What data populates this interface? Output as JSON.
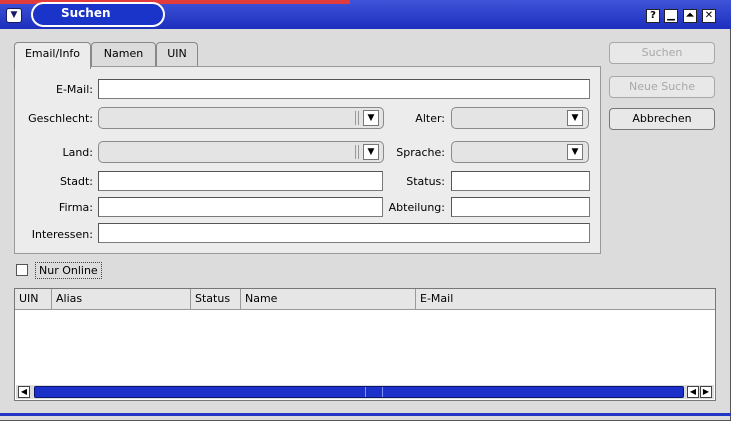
{
  "window": {
    "title": "Suchen",
    "menu_icon": "chevron-down-icon",
    "controls": [
      {
        "name": "help-icon",
        "glyph": "?"
      },
      {
        "name": "minimize-icon",
        "glyph": "▁"
      },
      {
        "name": "maximize-icon",
        "glyph": "⏶"
      },
      {
        "name": "close-icon",
        "glyph": "✕"
      }
    ]
  },
  "tabs": [
    {
      "label": "Email/Info",
      "active": true
    },
    {
      "label": "Namen",
      "active": false
    },
    {
      "label": "UIN",
      "active": false
    }
  ],
  "form": {
    "email_label": "E-Mail:",
    "gender_label": "Geschlecht:",
    "age_label": "Alter:",
    "country_label": "Land:",
    "language_label": "Sprache:",
    "city_label": "Stadt:",
    "status_label": "Status:",
    "company_label": "Firma:",
    "department_label": "Abteilung:",
    "interests_label": "Interessen:",
    "email_value": "",
    "city_value": "",
    "status_value": "",
    "company_value": "",
    "department_value": "",
    "interests_value": ""
  },
  "buttons": {
    "search": "Suchen",
    "new_search": "Neue Suche",
    "cancel": "Abbrechen"
  },
  "online_only": {
    "label": "Nur Online",
    "checked": false
  },
  "results": {
    "columns": [
      "UIN",
      "Alias",
      "Status",
      "Name",
      "E-Mail"
    ],
    "rows": []
  },
  "colors": {
    "titlebar": "#2437c4",
    "window_bg": "#dcdcdc",
    "scrollbar": "#1a30c8"
  }
}
